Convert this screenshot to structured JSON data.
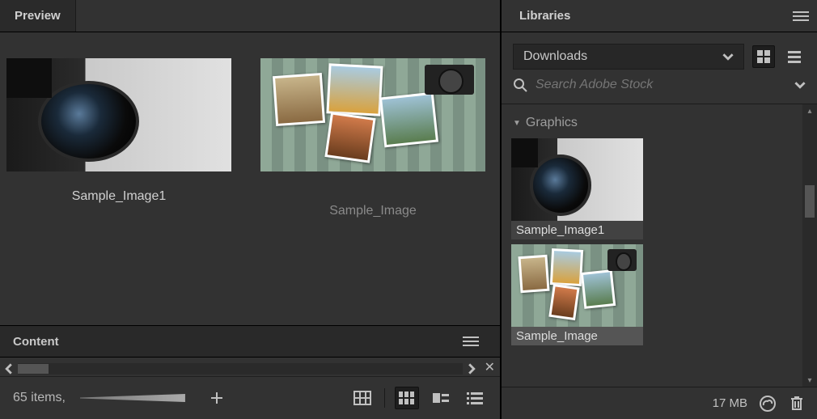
{
  "preview": {
    "tab_label": "Preview",
    "items": [
      {
        "label": "Sample_Image1"
      },
      {
        "label": "Sample_Image"
      }
    ]
  },
  "content": {
    "tab_label": "Content",
    "items_count": "65 items,"
  },
  "libraries": {
    "tab_label": "Libraries",
    "dropdown_selected": "Downloads",
    "search_placeholder": "Search Adobe Stock",
    "group_name": "Graphics",
    "items": [
      {
        "name": "Sample_Image1"
      },
      {
        "name": "Sample_Image"
      }
    ],
    "storage": "17 MB"
  }
}
